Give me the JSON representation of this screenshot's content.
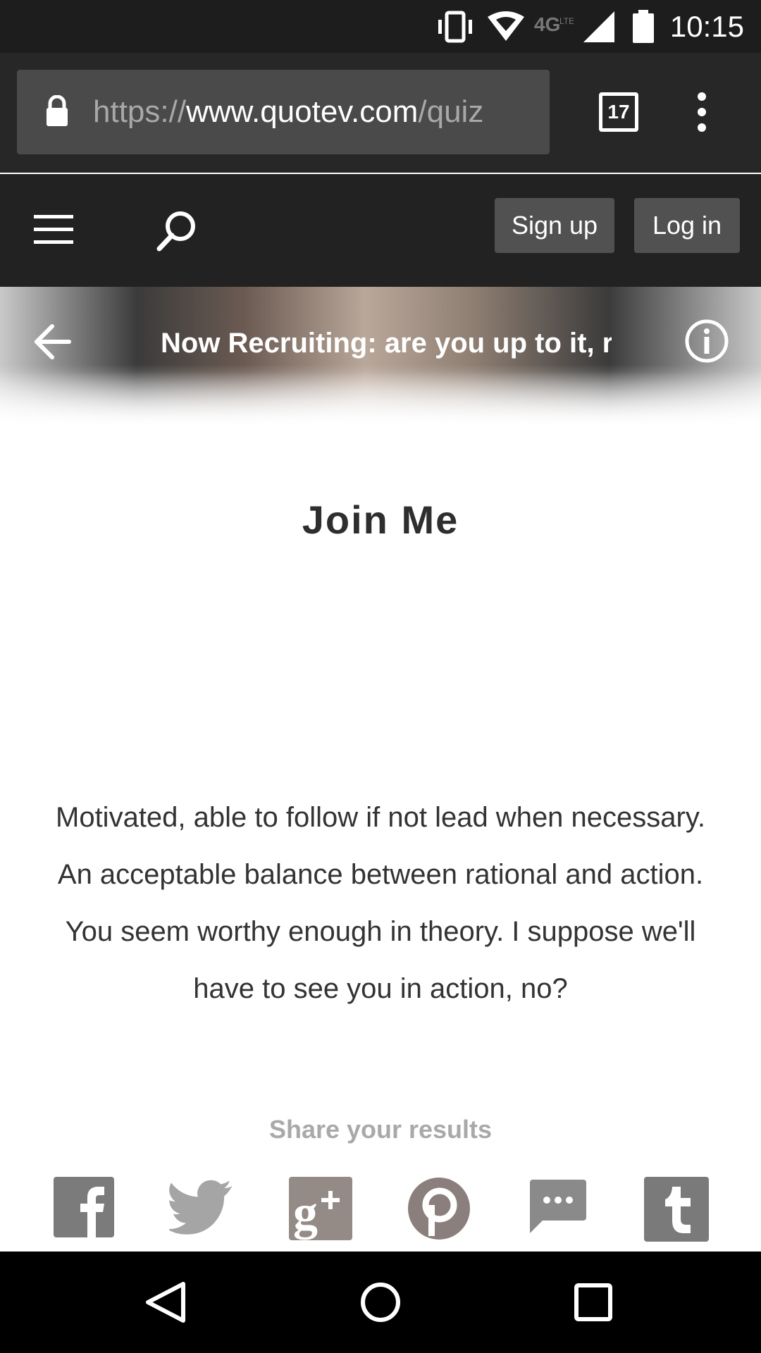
{
  "status_bar": {
    "time": "10:15",
    "icons": [
      "vibrate-icon",
      "wifi-icon",
      "lte-icon",
      "signal-icon",
      "battery-icon"
    ]
  },
  "browser": {
    "url_scheme": "https://",
    "url_host": "www.quotev.com",
    "url_path": "/quiz",
    "tab_count": "17"
  },
  "header": {
    "signup_label": "Sign up",
    "login_label": "Log in"
  },
  "hero": {
    "title": "Now Recruiting: are you up to it, r"
  },
  "result": {
    "title": "Join Me",
    "description": "Motivated, able to follow if not lead when necessary. An acceptable balance between rational and action. You seem worthy enough in theory. I suppose we'll have to see you in action, no?"
  },
  "share": {
    "label": "Share your results",
    "icons": [
      "facebook-icon",
      "twitter-icon",
      "google-plus-icon",
      "pinterest-icon",
      "sms-icon",
      "tumblr-icon"
    ]
  },
  "colors": {
    "status_bar": "#1d1d1d",
    "browser_bar": "#272727",
    "site_header": "#222222",
    "button": "#515151",
    "share_gray": "#8a8a8a"
  }
}
